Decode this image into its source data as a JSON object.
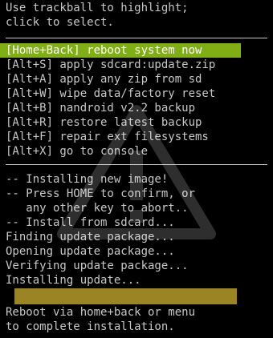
{
  "header": {
    "lines": [
      "Use trackball to highlight;",
      "click to select."
    ]
  },
  "menu": {
    "items": [
      {
        "label": "[Home+Back] reboot system now",
        "selected": true
      },
      {
        "label": "[Alt+S] apply sdcard:update.zip",
        "selected": false
      },
      {
        "label": "[Alt+A] apply any zip from sd",
        "selected": false
      },
      {
        "label": "[Alt+W] wipe data/factory reset",
        "selected": false
      },
      {
        "label": "[Alt+B] nandroid v2.2 backup",
        "selected": false
      },
      {
        "label": "[Alt+R] restore latest backup",
        "selected": false
      },
      {
        "label": "[Alt+F] repair ext filesystems",
        "selected": false
      },
      {
        "label": "[Alt+X] go to console",
        "selected": false
      }
    ]
  },
  "log": {
    "lines": [
      "-- Installing new image!",
      "-- Press HOME to confirm, or",
      "   any other key to abort..",
      "-- Install from sdcard...",
      "Finding update package...",
      "Opening update package...",
      "Verifying update package...",
      "Installing update..."
    ]
  },
  "progress": {
    "fraction": 1.0,
    "fill_color": "#9a8424",
    "track_color": "#555555"
  },
  "footer": {
    "lines": [
      "Reboot via home+back or menu",
      "to complete installation."
    ]
  },
  "colors": {
    "background": "#000000",
    "text": "#c8c8c8",
    "highlight": "#7fae15"
  },
  "watermark": {
    "icon": "warning-triangle-icon"
  }
}
